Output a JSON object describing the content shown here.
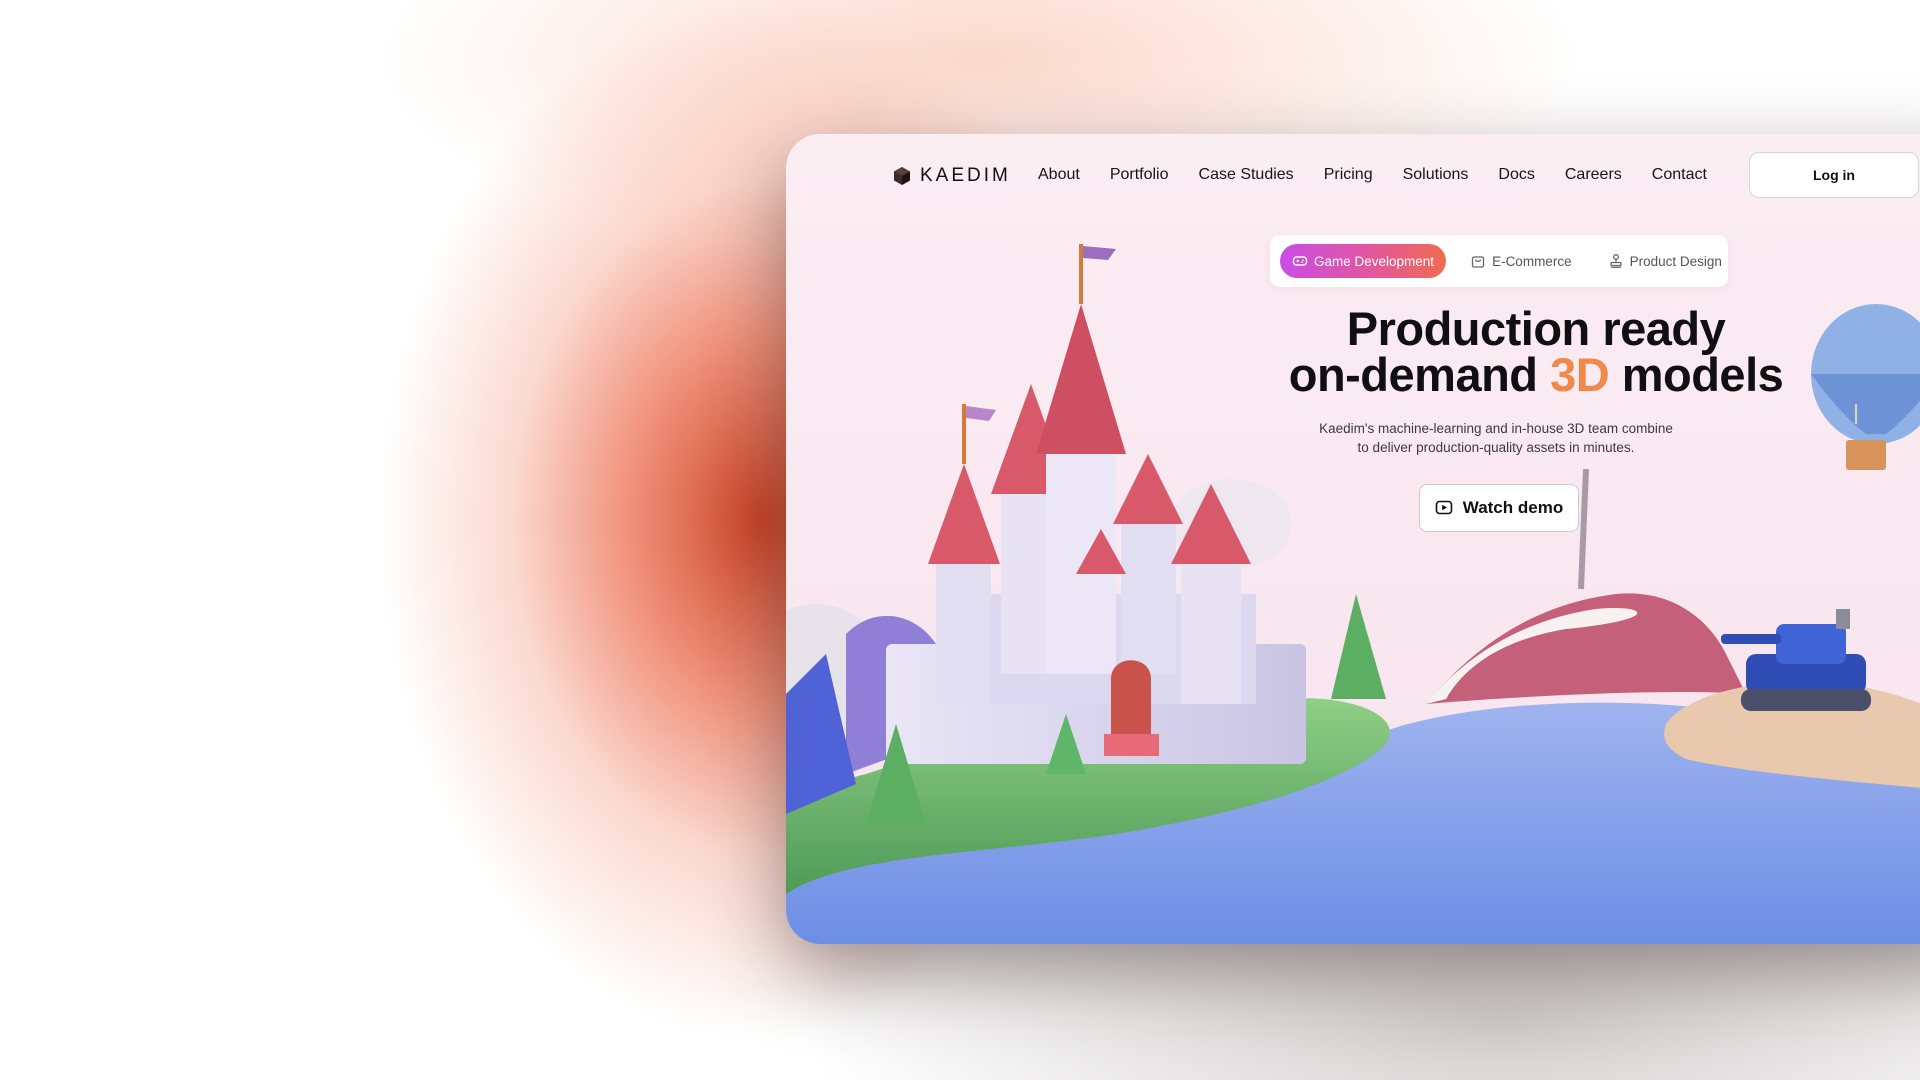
{
  "brand": {
    "name": "KAEDIM"
  },
  "nav": {
    "items": [
      "About",
      "Portfolio",
      "Case Studies",
      "Pricing",
      "Solutions",
      "Docs",
      "Careers",
      "Contact"
    ],
    "login_label": "Log in"
  },
  "tabs": [
    {
      "label": "Game Development",
      "icon": "gamepad-icon",
      "active": true
    },
    {
      "label": "E-Commerce",
      "icon": "shopping-bag-icon",
      "active": false
    },
    {
      "label": "Product Design",
      "icon": "stamp-icon",
      "active": false
    }
  ],
  "hero": {
    "title_line1": "Production ready",
    "title_line2_pre": "on-demand ",
    "title_line2_accent": "3D",
    "title_line2_post": " models",
    "subtitle_line1": "Kaedim's machine-learning and in-house 3D team combine",
    "subtitle_line2": "to deliver production-quality assets in minutes.",
    "cta_label": "Watch demo",
    "cta_icon": "play-icon"
  },
  "colors": {
    "accent": "#f08a4b",
    "tab_gradient_start": "#c94ce8",
    "tab_gradient_end": "#f06b50",
    "glow": "#d9482a"
  }
}
